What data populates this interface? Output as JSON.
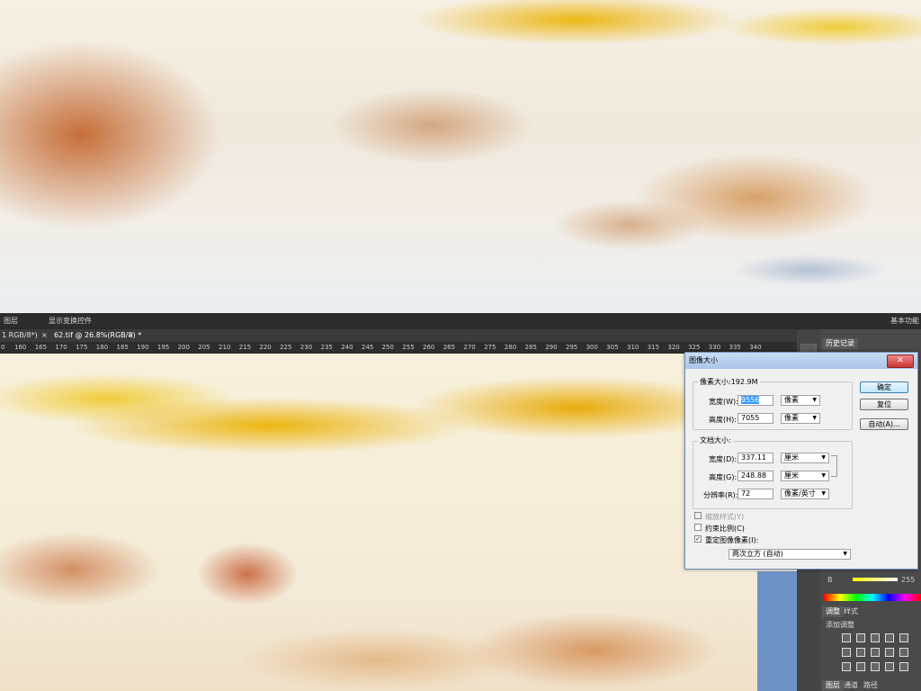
{
  "preview": {
    "alt": "landscape marble texture preview"
  },
  "menubar": {
    "item1": "图层",
    "item2": "显示变换控件",
    "right_label": "基本功能"
  },
  "tabs": {
    "tab1": "1 RGB/8*)",
    "tab1_close": "×",
    "tab2": "62.tif @ 26.8%(RGB/8) *",
    "tab2_close": "×"
  },
  "ruler": {
    "ticks": [
      "0",
      "160",
      "165",
      "170",
      "175",
      "180",
      "185",
      "190",
      "195",
      "200",
      "205",
      "210",
      "215",
      "220",
      "225",
      "230",
      "235",
      "240",
      "245",
      "250",
      "255",
      "260",
      "265",
      "270",
      "275",
      "280",
      "285",
      "290",
      "295",
      "300",
      "305",
      "310",
      "315",
      "320",
      "325",
      "330",
      "335",
      "340"
    ]
  },
  "panels": {
    "history_tab": "历史记录",
    "adjust_tab": "调整",
    "style_tab": "样式",
    "add_adjust": "添加调整",
    "bottom_tab1": "图层",
    "bottom_tab2": "通道",
    "bottom_tab3": "路径",
    "slider_label_b": "B",
    "slider_value": "255",
    "icon_names": [
      "brightness-icon",
      "levels-icon",
      "curves-icon",
      "exposure-icon",
      "vibrance-icon",
      "huesat-icon",
      "colorbalance-icon",
      "bw-icon",
      "photofilter-icon",
      "channelmixer-icon",
      "invert-icon",
      "posterize-icon",
      "threshold-icon",
      "gradientmap-icon",
      "selectivecolor-icon"
    ]
  },
  "dialog": {
    "title": "图像大小",
    "close": "✕",
    "pixel_size": "像素大小:192.9M",
    "width_label": "宽度(W):",
    "width_value": "9556",
    "width_unit": "像素",
    "height_label": "高度(H):",
    "height_value": "7055",
    "height_unit": "像素",
    "doc_size": "文档大小:",
    "doc_width_label": "宽度(D):",
    "doc_width_value": "337.11",
    "doc_width_unit": "厘米",
    "doc_height_label": "高度(G):",
    "doc_height_value": "248.88",
    "doc_height_unit": "厘米",
    "res_label": "分辨率(R):",
    "res_value": "72",
    "res_unit": "像素/英寸",
    "scale_styles": "缩放样式(Y)",
    "constrain": "约束比例(C)",
    "resample": "重定图像像素(I):",
    "resample_method": "两次立方 (自动)",
    "ok": "确定",
    "reset": "复位",
    "auto": "自动(A)..."
  }
}
